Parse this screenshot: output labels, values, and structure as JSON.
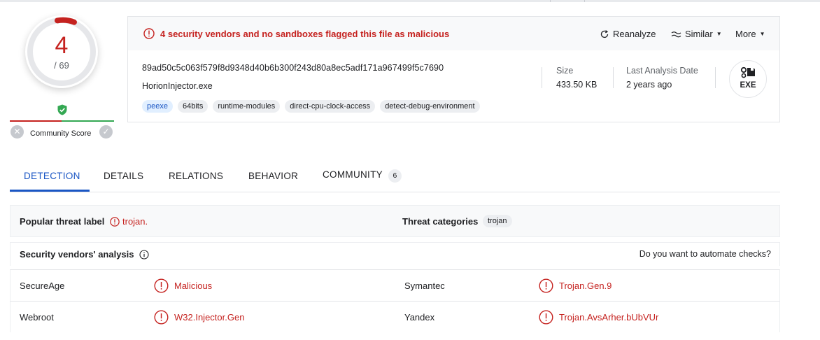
{
  "score": {
    "detected": "4",
    "total": "/ 69"
  },
  "community": {
    "label": "Community Score"
  },
  "banner": {
    "message": "4 security vendors and no sandboxes flagged this file as malicious",
    "actions": [
      {
        "label": "Reanalyze",
        "icon": "reanalyze-icon"
      },
      {
        "label": "Similar",
        "icon": "similar-icon"
      },
      {
        "label": "More"
      }
    ]
  },
  "file": {
    "hash": "89ad50c5c063f579f8d9348d40b6b300f243d80a8ec5adf171a967499f5c7690",
    "name": "HorionInjector.exe",
    "tags": [
      "peexe",
      "64bits",
      "runtime-modules",
      "direct-cpu-clock-access",
      "detect-debug-environment"
    ],
    "size_label": "Size",
    "size_value": "433.50 KB",
    "analysis_label": "Last Analysis Date",
    "analysis_value": "2 years ago",
    "type_badge": "EXE"
  },
  "tabs": [
    {
      "label": "DETECTION"
    },
    {
      "label": "DETAILS"
    },
    {
      "label": "RELATIONS"
    },
    {
      "label": "BEHAVIOR"
    },
    {
      "label": "COMMUNITY",
      "count": "6"
    }
  ],
  "threat": {
    "popular_label": "Popular threat label",
    "popular_value": "trojan.",
    "categories_label": "Threat categories",
    "categories_value": "trojan"
  },
  "vendors": {
    "title": "Security vendors' analysis",
    "automate": "Do you want to automate checks?",
    "rows": [
      {
        "left_name": "SecureAge",
        "left_result": "Malicious",
        "right_name": "Symantec",
        "right_result": "Trojan.Gen.9"
      },
      {
        "left_name": "Webroot",
        "left_result": "W32.Injector.Gen",
        "right_name": "Yandex",
        "right_result": "Trojan.AvsArher.bUbVUr"
      }
    ]
  },
  "colors": {
    "accent": "#1a56c4",
    "danger": "#c5221f",
    "success": "#34a853"
  }
}
